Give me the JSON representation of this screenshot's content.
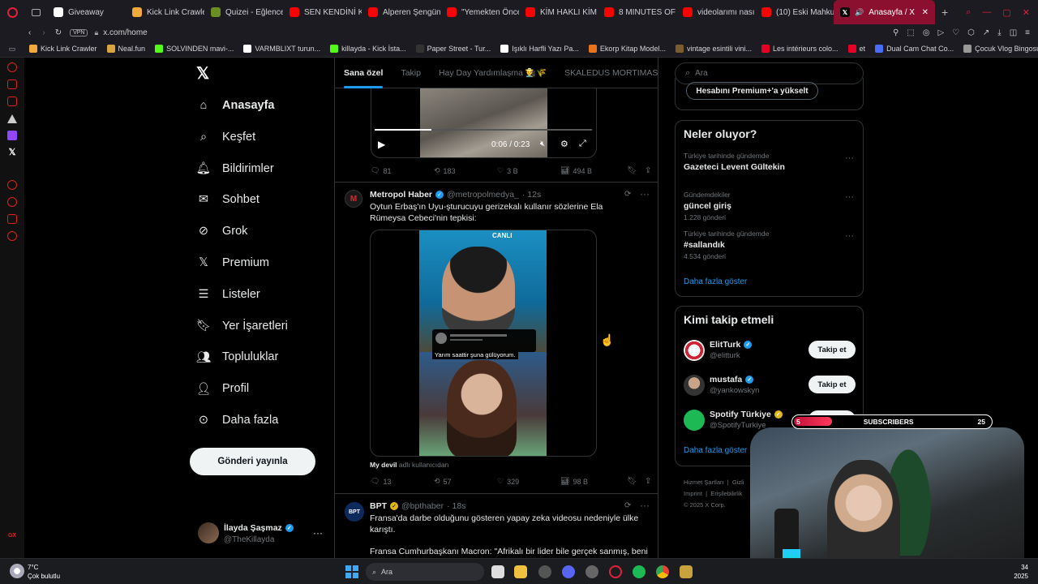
{
  "browser": {
    "tabs": [
      {
        "label": "Giveaway",
        "color": "#ffffff"
      },
      {
        "label": "Kick Link Crawler",
        "color": "#f2a93b"
      },
      {
        "label": "Quizei - Eğlenceli",
        "color": "#6b8e23"
      },
      {
        "label": "SEN KENDİNİ KU",
        "color": "#ff0000"
      },
      {
        "label": "Alperen Şengün 1",
        "color": "#ff0000"
      },
      {
        "label": "\"Yemekten Önce",
        "color": "#ff0000"
      },
      {
        "label": "KİM HAKLI KİM H",
        "color": "#ff0000"
      },
      {
        "label": "8 MINUTES OF G",
        "color": "#ff0000"
      },
      {
        "label": "videolarımı nasıl y",
        "color": "#ff0000"
      },
      {
        "label": "(10) Eski Mahkum",
        "color": "#ff0000"
      }
    ],
    "active_tab": "Anasayfa / X",
    "url": "x.com/home",
    "vpn": "VPN",
    "bookmarks": [
      {
        "label": "Kick Link Crawler",
        "color": "#f2a93b"
      },
      {
        "label": "Neal.fun",
        "color": "#d9a441"
      },
      {
        "label": "SOLVINDEN mavi-...",
        "color": "#53fc18"
      },
      {
        "label": "VARMBLIXT turun...",
        "color": "#ffffff"
      },
      {
        "label": "killayda - Kick İsta...",
        "color": "#53fc18"
      },
      {
        "label": "Paper Street - Tur...",
        "color": "#333333"
      },
      {
        "label": "Işıklı Harfli Yazı Pa...",
        "color": "#ffffff"
      },
      {
        "label": "Ekorp Kitap Model...",
        "color": "#e8731a"
      },
      {
        "label": "vintage esintili vini...",
        "color": "#7a5c2e"
      },
      {
        "label": "Les intérieurs colo...",
        "color": "#e60023"
      },
      {
        "label": "et",
        "color": "#e60023"
      },
      {
        "label": "Dual Cam Chat Co...",
        "color": "#4a6cf7"
      },
      {
        "label": "Çocuk Vlog Bingosu",
        "color": "#999999"
      }
    ]
  },
  "nav": {
    "items": [
      {
        "label": "Anasayfa",
        "icon": "home-icon"
      },
      {
        "label": "Keşfet",
        "icon": "search-icon"
      },
      {
        "label": "Bildirimler",
        "icon": "bell-icon"
      },
      {
        "label": "Sohbet",
        "icon": "mail-icon"
      },
      {
        "label": "Grok",
        "icon": "grok-icon"
      },
      {
        "label": "Premium",
        "icon": "x-logo-icon"
      },
      {
        "label": "Listeler",
        "icon": "list-icon"
      },
      {
        "label": "Yer İşaretleri",
        "icon": "bookmark-icon"
      },
      {
        "label": "Topluluklar",
        "icon": "people-icon"
      },
      {
        "label": "Profil",
        "icon": "person-icon"
      },
      {
        "label": "Daha fazla",
        "icon": "more-circle-icon"
      }
    ],
    "post_button": "Gönderi yayınla",
    "account_name": "İlayda Şaşmaz",
    "account_handle": "@TheKillayda"
  },
  "feed": {
    "tabs": [
      "Sana özel",
      "Takip",
      "Hay Day Yardımlaşma 👨‍🌾🌾",
      "SKALEDUS MORTIMAS"
    ],
    "video1": {
      "time": "0:06 / 0:23"
    },
    "tweet1_stats": {
      "replies": "81",
      "reposts": "183",
      "likes": "3 B",
      "views": "494 B"
    },
    "tweet2": {
      "name": "Metropol Haber",
      "handle": "@metropolmedya_",
      "time": "· 12s",
      "text": "Oytun Erbaş'ın Uyu-şturucuyu gerizekalı kullanır sözlerine Ela Rümeysa Cebeci'nin tepkisi:",
      "video_badge": "CANLI",
      "video_caption": "Yarım saattir şuna gülüyorum.",
      "footer_user": "My devil",
      "footer_rest": "adlı kullanıcıdan",
      "replies": "13",
      "reposts": "57",
      "likes": "329",
      "views": "98 B"
    },
    "tweet3": {
      "name": "BPT",
      "handle": "@bpthaber",
      "time": "· 18s",
      "text1": "Fransa'da darbe olduğunu gösteren yapay zeka videosu nedeniyle ülke karıştı.",
      "text2": "Fransa Cumhurbaşkanı Macron: \"Afrikalı bir lider bile gerçek sanmış, beni"
    }
  },
  "sidebar": {
    "search_placeholder": "Ara",
    "premium_button": "Hesabını Premium+'a yükselt",
    "trends_title": "Neler oluyor?",
    "trends": [
      {
        "meta": "Türkiye tarihinde gündemde",
        "title": "Gazeteci Levent Gültekin",
        "count": ""
      },
      {
        "meta": "Gündemdekiler",
        "title": "güncel giriş",
        "count": "1.228 gönderi"
      },
      {
        "meta": "Türkiye tarihinde gündemde",
        "title": "#sallandık",
        "count": "4.534 gönderi"
      }
    ],
    "show_more": "Daha fazla göster",
    "follow_title": "Kimi takip etmeli",
    "follow": [
      {
        "name": "ElitTurk",
        "handle": "@elitturk",
        "button": "Takip et"
      },
      {
        "name": "mustafa",
        "handle": "@yankowskyn",
        "button": "Takip et"
      },
      {
        "name": "Spotify Türkiye",
        "handle": "@SpotifyTurkiye",
        "button": "Takip et"
      }
    ],
    "follow_more": "Daha fazla göster",
    "footer1": "Hizmet Şartları",
    "footer1b": "Gizli",
    "footer2": "Imprint",
    "footer2b": "Erişilebilirlik",
    "footer3": "© 2025 X Corp."
  },
  "overlay": {
    "left": "5",
    "label": "SUBSCRIBERS",
    "right": "25"
  },
  "taskbar": {
    "temp": "7°C",
    "weather": "Çok bulutlu",
    "search": "Ara",
    "clock_time": "34",
    "clock_date": "2025"
  }
}
